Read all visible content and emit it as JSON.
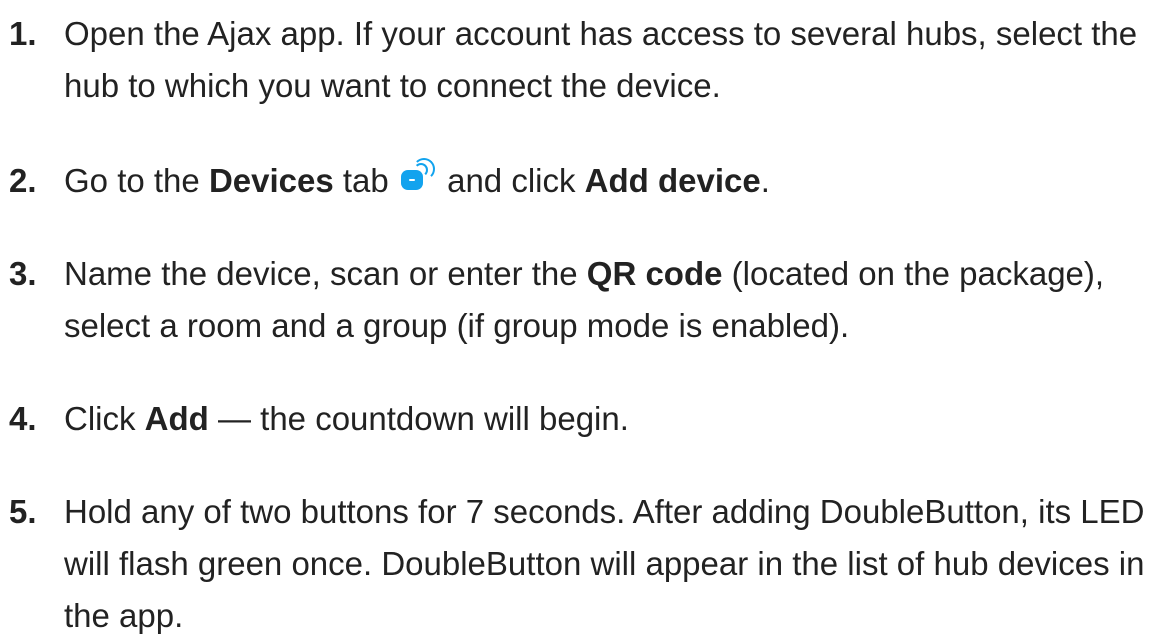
{
  "steps": [
    {
      "number": "1.",
      "segments": [
        {
          "text": "Open the Ajax app. If your account has access to several hubs, select the hub to which you want to connect the device."
        }
      ]
    },
    {
      "number": "2.",
      "segments": [
        {
          "text": "Go to the "
        },
        {
          "text": "Devices",
          "bold": true
        },
        {
          "text": " tab "
        },
        {
          "icon": "devices-tab-icon"
        },
        {
          "text": " and click "
        },
        {
          "text": "Add device",
          "bold": true
        },
        {
          "text": "."
        }
      ]
    },
    {
      "number": "3.",
      "segments": [
        {
          "text": "Name the device, scan or enter the "
        },
        {
          "text": "QR code",
          "bold": true
        },
        {
          "text": " (located on the package), select a room and a group (if group mode is enabled)."
        }
      ]
    },
    {
      "number": "4.",
      "segments": [
        {
          "text": "Click "
        },
        {
          "text": "Add",
          "bold": true
        },
        {
          "text": " — the countdown will begin."
        }
      ]
    },
    {
      "number": "5.",
      "segments": [
        {
          "text": "Hold any of two buttons for 7 seconds. After adding DoubleButton, its LED will flash green once. DoubleButton will appear in the list of hub devices in the app."
        }
      ]
    }
  ],
  "colors": {
    "text": "#222222",
    "icon_accent": "#12a3ee"
  }
}
